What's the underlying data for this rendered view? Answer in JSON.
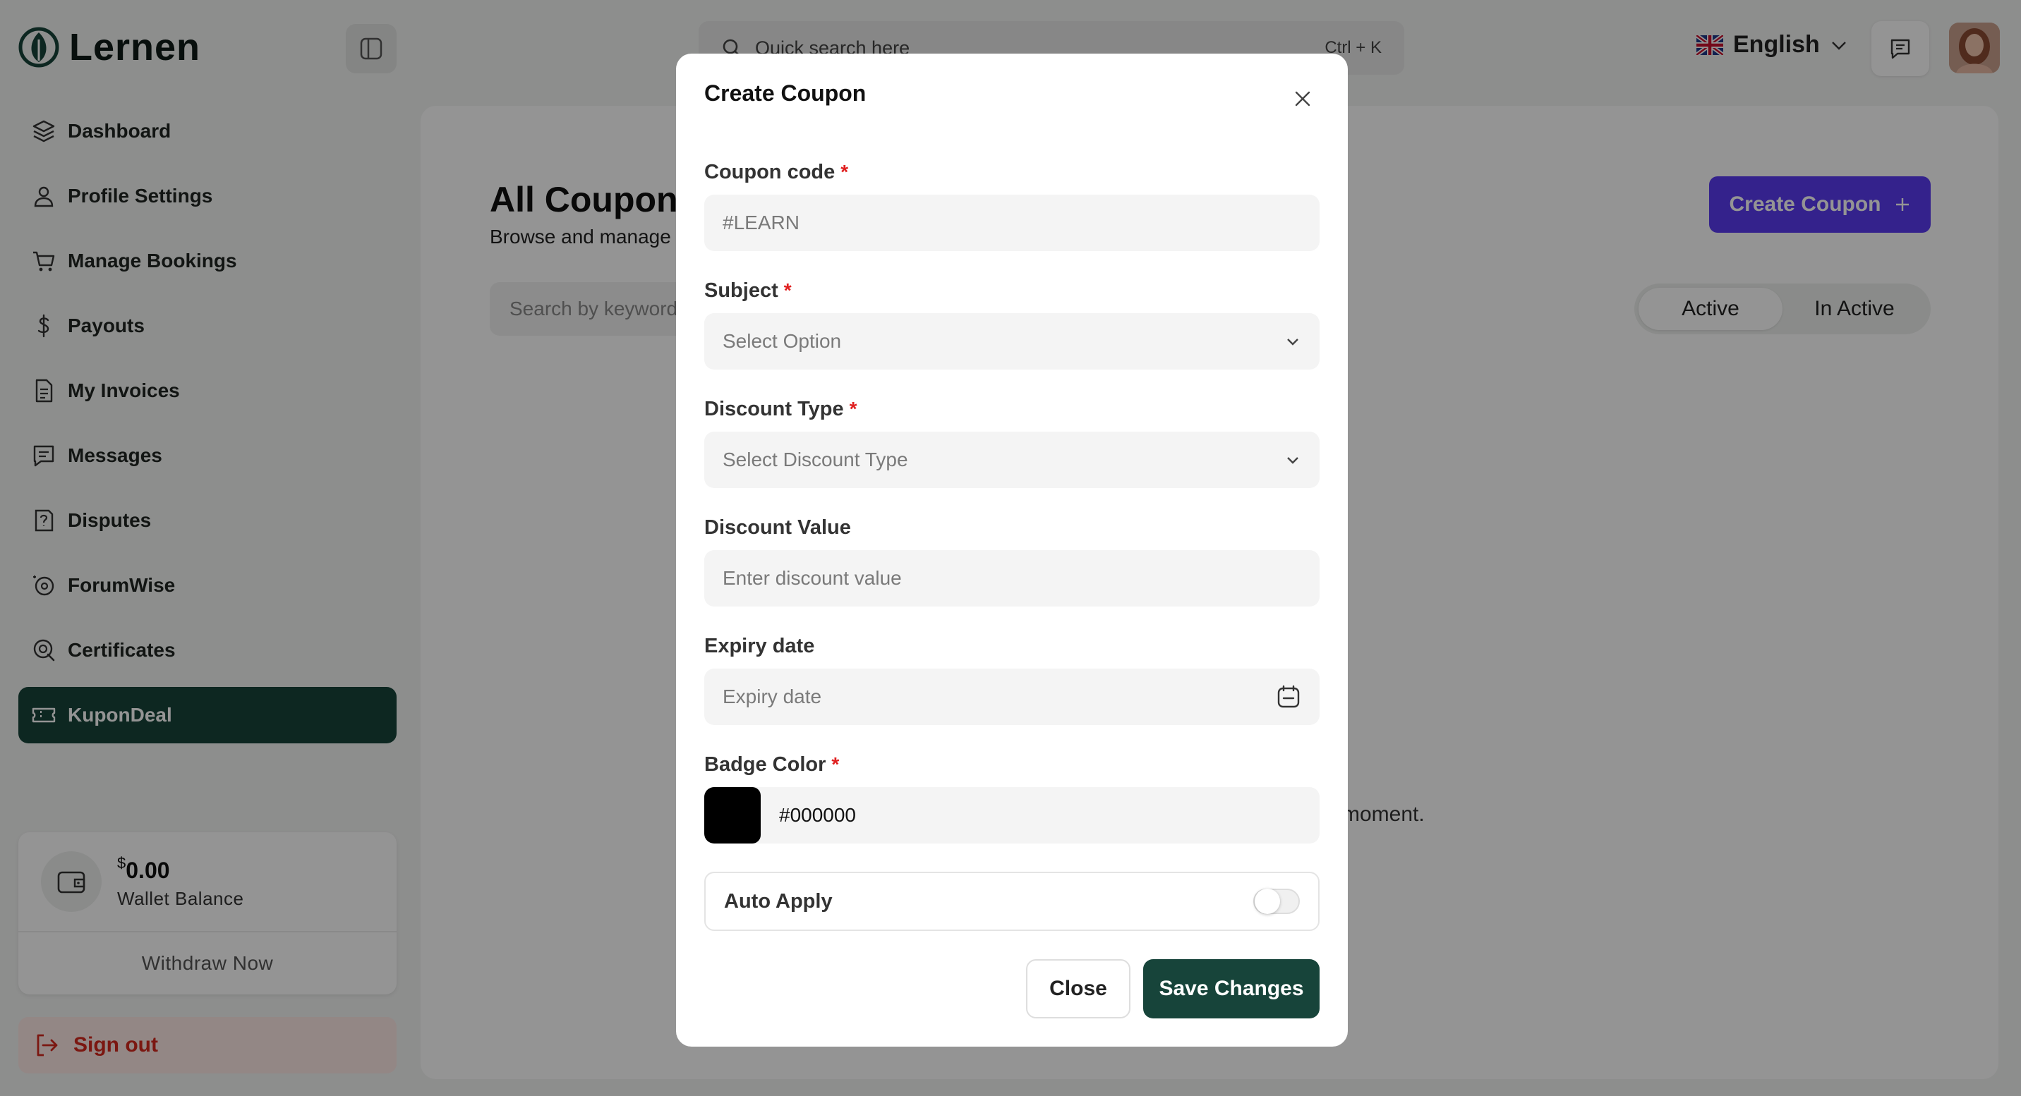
{
  "app": {
    "name": "Lernen",
    "brand_color": "#17443a",
    "accent_color": "#5b3cf2",
    "danger_color": "#d4281e"
  },
  "sidebar": {
    "items": [
      {
        "label": "Dashboard",
        "icon": "layers-icon"
      },
      {
        "label": "Profile Settings",
        "icon": "user-icon"
      },
      {
        "label": "Manage Bookings",
        "icon": "cart-icon"
      },
      {
        "label": "Payouts",
        "icon": "dollar-icon"
      },
      {
        "label": "My Invoices",
        "icon": "invoice-icon"
      },
      {
        "label": "Messages",
        "icon": "message-icon"
      },
      {
        "label": "Disputes",
        "icon": "dispute-icon"
      },
      {
        "label": "ForumWise",
        "icon": "forum-icon"
      },
      {
        "label": "Certificates",
        "icon": "certificate-icon"
      },
      {
        "label": "KuponDeal",
        "icon": "ticket-icon",
        "active": true
      }
    ],
    "wallet": {
      "currency": "$",
      "amount": "0.00",
      "label": "Wallet Balance",
      "withdraw_label": "Withdraw Now"
    },
    "signout_label": "Sign out"
  },
  "topbar": {
    "search_placeholder": "Quick search here",
    "search_shortcut": "Ctrl + K",
    "language": "English"
  },
  "page": {
    "title": "All Coupons",
    "subtitle": "Browse and manage all coupons",
    "keyword_placeholder": "Search by keyword",
    "create_button": "Create Coupon",
    "filters": [
      "Active",
      "In Active"
    ],
    "active_filter": "Active",
    "empty_message_fragment": "moment."
  },
  "modal": {
    "title": "Create Coupon",
    "fields": {
      "coupon_code": {
        "label": "Coupon code",
        "placeholder": "#LEARN",
        "required": true
      },
      "subject": {
        "label": "Subject",
        "value": "Select Option",
        "required": true
      },
      "discount_type": {
        "label": "Discount Type",
        "value": "Select Discount Type",
        "required": true
      },
      "discount_value": {
        "label": "Discount Value",
        "placeholder": "Enter discount value",
        "required": false
      },
      "expiry_date": {
        "label": "Expiry date",
        "placeholder": "Expiry date",
        "required": false
      },
      "badge_color": {
        "label": "Badge Color",
        "value": "#000000",
        "required": true
      }
    },
    "auto_apply_label": "Auto Apply",
    "auto_apply_on": false,
    "required_mark": "*",
    "close_button": "Close",
    "save_button": "Save Changes"
  }
}
